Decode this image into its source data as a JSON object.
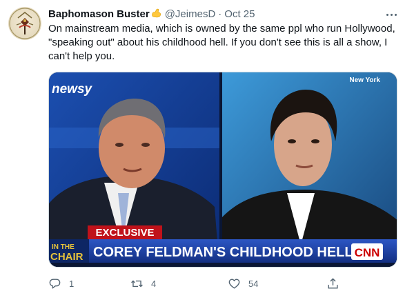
{
  "tweet": {
    "author_name": "Baphomason Buster",
    "author_emoji": "flexed-biceps",
    "handle": "@JeimesD",
    "separator": "·",
    "date": "Oct 25",
    "text": "On mainstream media, which is owned by the same ppl who run Hollywood, \"speaking out\" about his childhood hell. If you don't see this is all a show, I can't help you.",
    "media": {
      "network_logo": "newsy",
      "location_label": "New York",
      "segment_badge": "EXCLUSIVE",
      "show_logo_top": "IN THE",
      "show_logo_bottom": "CHAIR",
      "headline": "COREY FELDMAN'S CHILDHOOD HELL",
      "channel_logo": "CNN"
    },
    "actions": {
      "reply_count": "1",
      "retweet_count": "4",
      "like_count": "54"
    }
  },
  "colors": {
    "text_primary": "#0f1419",
    "text_secondary": "#536471",
    "border": "#cfd9de",
    "emoji": "#ffc83d",
    "chyron_blue": "#1f3f9e",
    "badge_red": "#c0121a",
    "cnn_red": "#cc0000"
  },
  "icons": [
    "avatar",
    "flexed-biceps-emoji",
    "more-icon",
    "reply-icon",
    "retweet-icon",
    "like-icon",
    "share-icon"
  ]
}
